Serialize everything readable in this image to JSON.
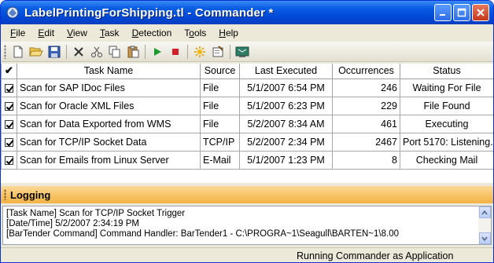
{
  "window": {
    "title": "LabelPrintingForShipping.tl - Commander *",
    "controls": [
      "minimize",
      "maximize",
      "close"
    ]
  },
  "menu": [
    {
      "label": "File",
      "accel": "F",
      "rest": "ile"
    },
    {
      "label": "Edit",
      "accel": "E",
      "rest": "dit"
    },
    {
      "label": "View",
      "accel": "V",
      "rest": "iew"
    },
    {
      "label": "Task",
      "accel": "T",
      "rest": "ask"
    },
    {
      "label": "Detection",
      "accel": "D",
      "rest": "etection"
    },
    {
      "label": "Tools",
      "pre": "T",
      "accel": "o",
      "rest": "ols"
    },
    {
      "label": "Help",
      "accel": "H",
      "rest": "elp"
    }
  ],
  "toolbar": {
    "icons": [
      "new-file-icon",
      "open-folder-icon",
      "save-icon",
      "delete-icon",
      "cut-icon",
      "copy-icon",
      "paste-icon",
      "start-icon",
      "stop-icon",
      "detection-icon",
      "properties-icon",
      "options-icon"
    ]
  },
  "table": {
    "columns": [
      "✔",
      "Task Name",
      "Source",
      "Last Executed",
      "Occurrences",
      "Status"
    ],
    "rows": [
      {
        "checked": true,
        "task": "Scan for SAP IDoc Files",
        "source": "File",
        "last": "5/1/2007 6:54 PM",
        "occurrences": "246",
        "status": "Waiting For File"
      },
      {
        "checked": true,
        "task": "Scan for Oracle XML Files",
        "source": "File",
        "last": "5/1/2007 6:23 PM",
        "occurrences": "229",
        "status": "File Found"
      },
      {
        "checked": true,
        "task": "Scan for Data Exported from WMS",
        "source": "File",
        "last": "5/2/2007 8:34 AM",
        "occurrences": "461",
        "status": "Executing"
      },
      {
        "checked": true,
        "task": "Scan for TCP/IP Socket Data",
        "source": "TCP/IP",
        "last": "5/2/2007 2:34 PM",
        "occurrences": "2467",
        "status": "Port 5170: Listening."
      },
      {
        "checked": true,
        "task": "Scan for Emails from Linux Server",
        "source": "E-Mail",
        "last": "5/1/2007 1:23 PM",
        "occurrences": "8",
        "status": "Checking Mail"
      }
    ]
  },
  "logging": {
    "title": "Logging",
    "lines": [
      "[Task Name] Scan for TCP/IP Socket Trigger",
      "[Date/Time] 5/2/2007 2:34:19 PM",
      "[BarTender Command] Command Handler: BarTender1 - C:\\PROGRA~1\\Seagull\\BARTEN~1\\8.00"
    ]
  },
  "status": {
    "text": "Running Commander as Application"
  },
  "colors": {
    "titlebar": "#0a5fe3",
    "logging_header": "#f7c160",
    "window_face": "#ece9d8"
  }
}
